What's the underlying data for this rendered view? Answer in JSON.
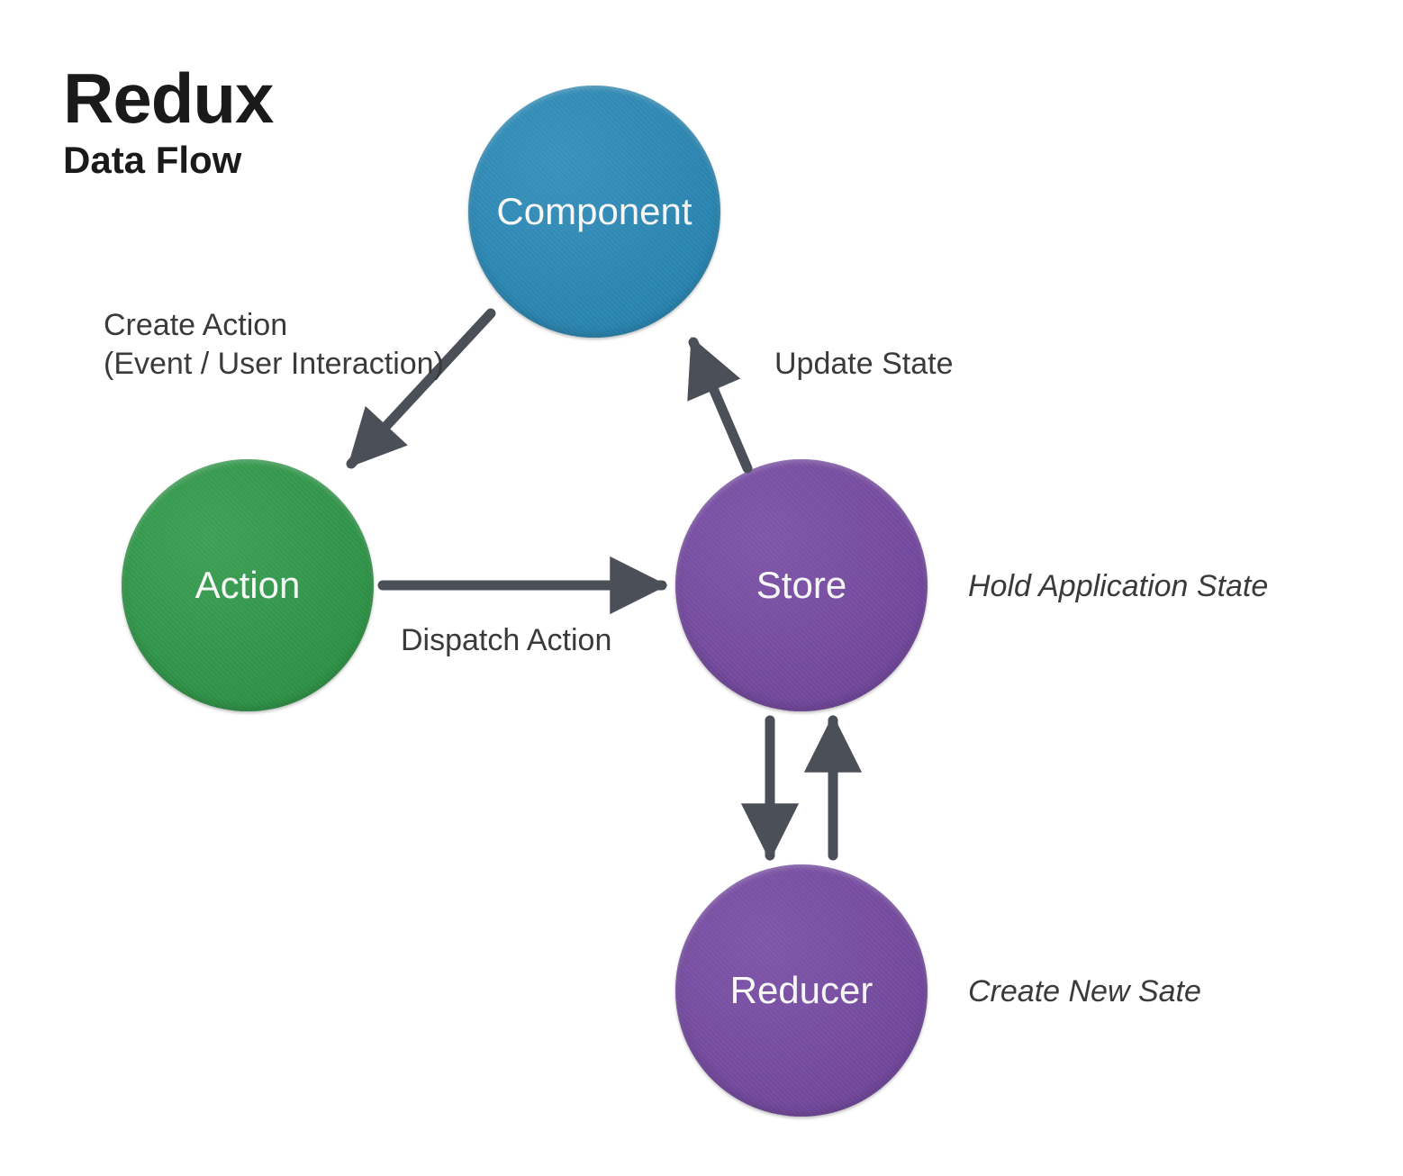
{
  "title": {
    "main": "Redux",
    "sub": "Data Flow"
  },
  "nodes": {
    "component": {
      "label": "Component",
      "color": "#2a8bb9"
    },
    "action": {
      "label": "Action",
      "color": "#2f9a49"
    },
    "store": {
      "label": "Store",
      "color": "#774aa4"
    },
    "reducer": {
      "label": "Reducer",
      "color": "#774aa4"
    }
  },
  "edge_labels": {
    "create_action_line1": "Create Action",
    "create_action_line2": "(Event / User Interaction)",
    "dispatch_action": "Dispatch Action",
    "update_state": "Update State"
  },
  "annotations": {
    "store_note": "Hold Application State",
    "reducer_note": "Create New Sate"
  },
  "arrow_color": "#4b5058"
}
